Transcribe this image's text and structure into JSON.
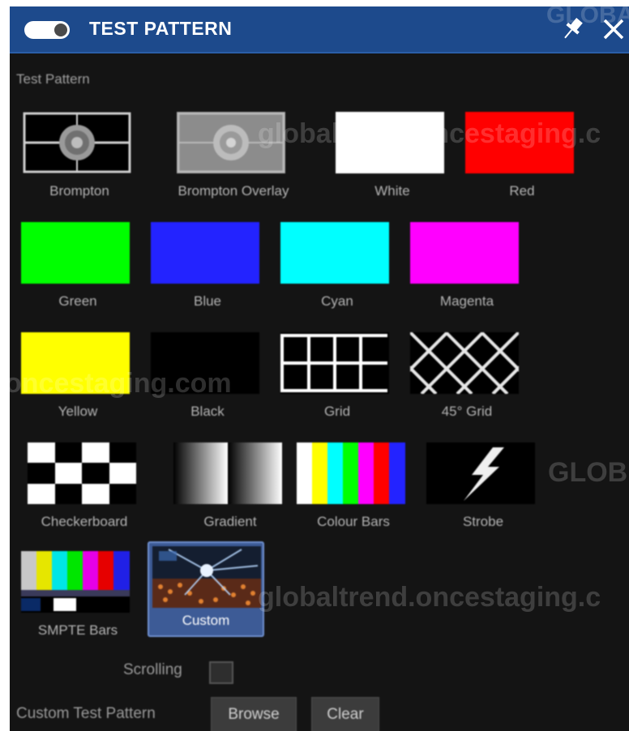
{
  "window": {
    "title": "TEST PATTERN",
    "toggle_on": true,
    "accent_color": "#1d4a8c"
  },
  "section_label": "Test Pattern",
  "patterns": [
    {
      "label": "Brompton",
      "icon": "brompton-pattern"
    },
    {
      "label": "Brompton Overlay",
      "icon": "brompton-overlay-pattern"
    },
    {
      "label": "White",
      "color": "#ffffff"
    },
    {
      "label": "Red",
      "color": "#ff0000"
    },
    {
      "label": "Green",
      "color": "#00ff00"
    },
    {
      "label": "Blue",
      "color": "#2323ff"
    },
    {
      "label": "Cyan",
      "color": "#00ffff"
    },
    {
      "label": "Magenta",
      "color": "#ff00ff"
    },
    {
      "label": "Yellow",
      "color": "#ffff00"
    },
    {
      "label": "Black",
      "color": "#000000"
    },
    {
      "label": "Grid",
      "icon": "grid-pattern"
    },
    {
      "label": "45° Grid",
      "icon": "diagonal-grid-pattern"
    },
    {
      "label": "Checkerboard",
      "icon": "checkerboard-pattern"
    },
    {
      "label": "Gradient",
      "icon": "gradient-pattern"
    },
    {
      "label": "Colour Bars",
      "icon": "colour-bars-pattern"
    },
    {
      "label": "Strobe",
      "icon": "strobe-pattern"
    },
    {
      "label": "SMPTE Bars",
      "icon": "smpte-bars-pattern"
    },
    {
      "label": "Custom",
      "icon": "custom-image-pattern",
      "selected": true
    }
  ],
  "scrolling": {
    "label": "Scrolling",
    "checked": false
  },
  "custom_test_pattern": {
    "label": "Custom Test Pattern",
    "browse_label": "Browse",
    "clear_label": "Clear"
  },
  "watermarks": {
    "top": "GLOBAL",
    "row1": "globaltrend.oncestaging.c",
    "mid": "oncestaging.com",
    "right": "GLOB",
    "row5": "globaltrend.oncestaging.c"
  }
}
